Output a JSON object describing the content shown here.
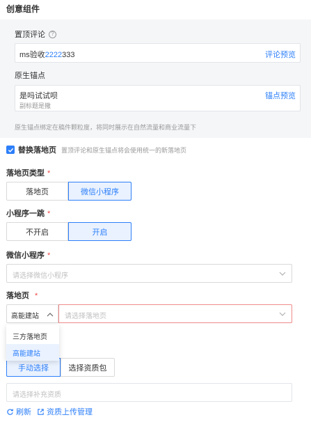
{
  "section_title": "创意组件",
  "pinned_comment": {
    "label": "置顶评论",
    "help_icon": "question-circle-icon",
    "value_prefix": "ms验收",
    "value_highlight": "2222",
    "value_suffix": "333",
    "preview_link": "评论预览"
  },
  "native_anchor": {
    "label": "原生锚点",
    "title": "是吗试试呗",
    "subtitle": "副标题是撒",
    "preview_link": "锚点预览",
    "note": "原生锚点绑定在稿件颗粒度，将同时展示在自然流量和商业流量下"
  },
  "replace_landing": {
    "checked": true,
    "label": "替换落地页",
    "description": "置顶评论和原生锚点将会使用统一的新落地页"
  },
  "landing_type": {
    "label": "落地页类型",
    "options": [
      "落地页",
      "微信小程序"
    ],
    "selected_index": 1
  },
  "mini_jump": {
    "label": "小程序一跳",
    "options": [
      "不开启",
      "开启"
    ],
    "selected_index": 1
  },
  "wechat_mini": {
    "label": "微信小程序",
    "placeholder": "请选择微信小程序"
  },
  "landing_page": {
    "label": "落地页",
    "type_value": "高能建站",
    "placeholder": "请选择落地页",
    "dropdown_options": [
      "三方落地页",
      "高能建站"
    ],
    "dropdown_selected_index": 1
  },
  "source_tabs": {
    "options": [
      "手动选择",
      "选择资质包"
    ],
    "selected_index": 0
  },
  "supplement": {
    "placeholder": "请选择补充资质"
  },
  "actions": {
    "refresh": "刷新",
    "upload_manage": "资质上传管理"
  },
  "colors": {
    "accent": "#2d7ff9",
    "required": "#f04a4a",
    "error_border": "#f08a8a"
  }
}
